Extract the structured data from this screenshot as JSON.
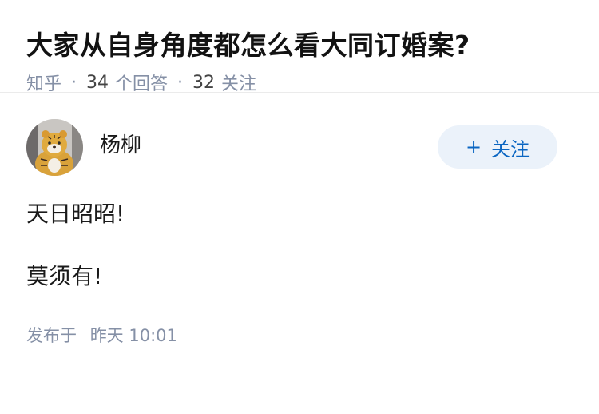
{
  "question": {
    "title": "大家从自身角度都怎么看大同订婚案?",
    "source": "知乎",
    "separator": "·",
    "answer_count": "34",
    "answer_count_label": "个回答",
    "follower_count": "32",
    "follower_label": "关注"
  },
  "answer": {
    "author_name": "杨柳",
    "avatar_icon": "tiger-avatar-icon",
    "follow_plus": "+",
    "follow_label": "关注",
    "paragraphs": [
      "天日昭昭!",
      "莫须有!"
    ],
    "published_prefix": "发布于",
    "published_time": "昨天 10:01"
  },
  "colors": {
    "title": "#121212",
    "meta": "#8590a6",
    "follow_bg": "#ebf2fa",
    "follow_text": "#0b66c2"
  }
}
